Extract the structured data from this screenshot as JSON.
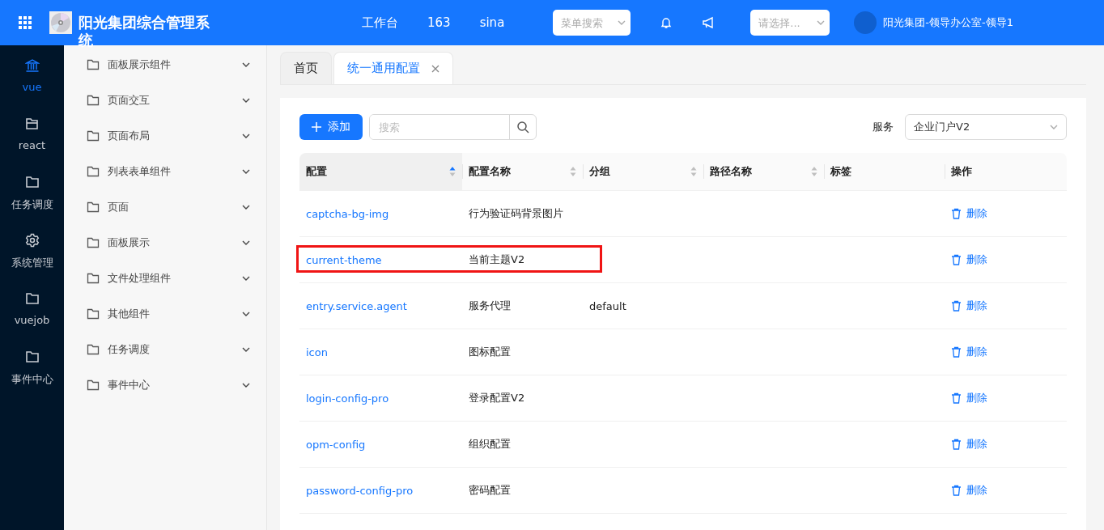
{
  "header": {
    "title": "阳光集团综合管理系统",
    "nav": [
      "工作台",
      "163",
      "sina"
    ],
    "menu_search": {
      "placeholder": "菜单搜索"
    },
    "org_select": {
      "placeholder": "请选择..."
    },
    "user": "阳光集团-领导办公室-领导1"
  },
  "rail": [
    {
      "label": "vue",
      "kind": "bank",
      "selected": true
    },
    {
      "label": "react",
      "kind": "open",
      "selected": false
    },
    {
      "label": "任务调度",
      "kind": "folder",
      "selected": false
    },
    {
      "label": "系统管理",
      "kind": "gear",
      "selected": false
    },
    {
      "label": "vuejob",
      "kind": "folder",
      "selected": false
    },
    {
      "label": "事件中心",
      "kind": "folder",
      "selected": false
    }
  ],
  "menu": [
    {
      "label": "面板展示组件",
      "expanded": false
    },
    {
      "label": "页面交互",
      "expanded": false
    },
    {
      "label": "页面布局",
      "expanded": false
    },
    {
      "label": "列表表单组件",
      "expanded": false
    },
    {
      "label": "页面",
      "expanded": false
    },
    {
      "label": "面板展示",
      "expanded": false
    },
    {
      "label": "文件处理组件",
      "expanded": false
    },
    {
      "label": "其他组件",
      "expanded": false
    },
    {
      "label": "任务调度",
      "expanded": false
    },
    {
      "label": "事件中心",
      "expanded": false
    }
  ],
  "tabs": [
    {
      "label": "首页",
      "selected": false,
      "closable": false
    },
    {
      "label": "统一通用配置",
      "selected": true,
      "closable": true
    }
  ],
  "toolbar": {
    "add": "添加",
    "search": {
      "placeholder": "搜索"
    },
    "service_label": "服务",
    "service_value": "企业门户V2"
  },
  "table": {
    "columns": [
      {
        "label": "配置",
        "sortable": true,
        "sorted": true
      },
      {
        "label": "配置名称",
        "sortable": true,
        "sorted": false
      },
      {
        "label": "分组",
        "sortable": true,
        "sorted": false
      },
      {
        "label": "路径名称",
        "sortable": true,
        "sorted": false
      },
      {
        "label": "标签",
        "sortable": false
      },
      {
        "label": "操作",
        "sortable": false
      }
    ],
    "rows": [
      {
        "key": "captcha-bg-img",
        "name": "行为验证码背景图片",
        "highlighted": false,
        "action": "删除"
      },
      {
        "key": "current-theme",
        "name": "当前主题V2",
        "highlighted": true,
        "action": "删除"
      },
      {
        "key": "entry.service.agent",
        "name": "服务代理",
        "group": "default",
        "highlighted": false,
        "action": "删除"
      },
      {
        "key": "icon",
        "name": "图标配置",
        "highlighted": false,
        "action": "删除"
      },
      {
        "key": "login-config-pro",
        "name": "登录配置V2",
        "highlighted": false,
        "action": "删除"
      },
      {
        "key": "opm-config",
        "name": "组织配置",
        "highlighted": false,
        "action": "删除"
      },
      {
        "key": "password-config-pro",
        "name": "密码配置",
        "highlighted": false,
        "action": "删除"
      }
    ]
  }
}
